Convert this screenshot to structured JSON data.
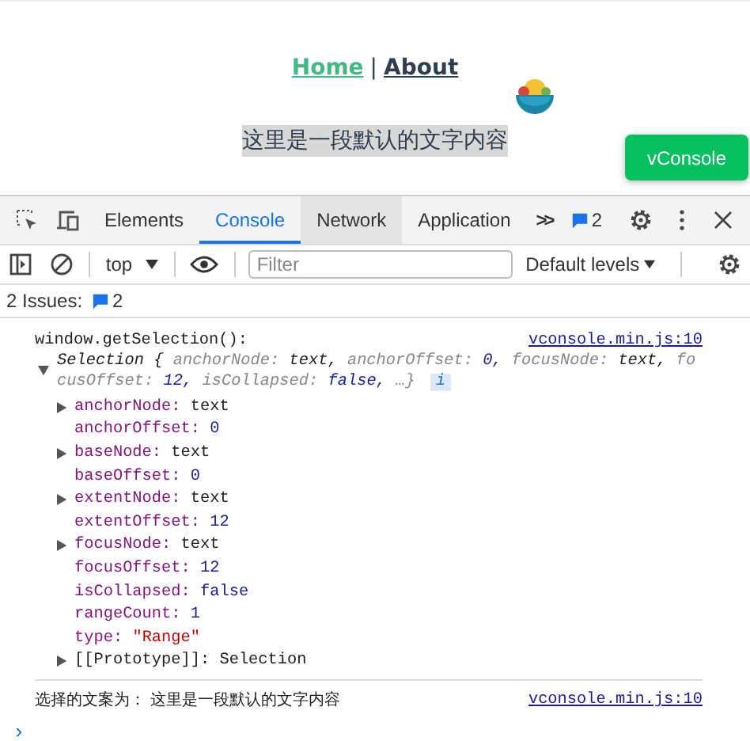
{
  "page": {
    "nav": [
      {
        "label": "Home",
        "selected": true
      },
      {
        "label": "About",
        "selected": false
      }
    ],
    "separator": "|",
    "selected_text": "这里是一段默认的文字内容",
    "vconsole_button": "vConsole"
  },
  "devtools": {
    "tabs": [
      {
        "label": "Elements",
        "selected": false,
        "hovered": false
      },
      {
        "label": "Console",
        "selected": true,
        "hovered": false
      },
      {
        "label": "Network",
        "selected": false,
        "hovered": true
      },
      {
        "label": "Application",
        "selected": false,
        "hovered": false
      }
    ],
    "more_tabs": ">>",
    "issues_badge": "2",
    "toolbar": {
      "context": "top",
      "filter_placeholder": "Filter",
      "levels": "Default levels"
    },
    "issues": {
      "label": "2 Issues:",
      "count": "2"
    },
    "console": {
      "log": "window.getSelection():",
      "source": "vconsole.min.js:10",
      "summary": {
        "parts": [
          {
            "text": "Selection {",
            "kind": "name"
          },
          {
            "text": "anchorNode:",
            "kind": "key"
          },
          {
            "text": "text,",
            "kind": "node"
          },
          {
            "text": "anchorOffset:",
            "kind": "key"
          },
          {
            "text": "0,",
            "kind": "number"
          },
          {
            "text": "focusNode:",
            "kind": "key"
          },
          {
            "text": "text,",
            "kind": "node"
          },
          {
            "text": "focusOffset:",
            "kind": "key"
          },
          {
            "text": "12,",
            "kind": "number"
          },
          {
            "text": "isCollapsed:",
            "kind": "key"
          },
          {
            "text": "false,",
            "kind": "boolean"
          },
          {
            "text": "…}",
            "kind": "key"
          }
        ],
        "info": "i",
        "expanded": true
      },
      "properties": [
        {
          "key": "anchorNode:",
          "value": "text",
          "kind": "node",
          "expandable": true
        },
        {
          "key": "anchorOffset:",
          "value": "0",
          "kind": "number",
          "expandable": false
        },
        {
          "key": "baseNode:",
          "value": "text",
          "kind": "node",
          "expandable": true
        },
        {
          "key": "baseOffset:",
          "value": "0",
          "kind": "number",
          "expandable": false
        },
        {
          "key": "extentNode:",
          "value": "text",
          "kind": "node",
          "expandable": true
        },
        {
          "key": "extentOffset:",
          "value": "12",
          "kind": "number",
          "expandable": false
        },
        {
          "key": "focusNode:",
          "value": "text",
          "kind": "node",
          "expandable": true
        },
        {
          "key": "focusOffset:",
          "value": "12",
          "kind": "number",
          "expandable": false
        },
        {
          "key": "isCollapsed:",
          "value": "false",
          "kind": "boolean",
          "expandable": false
        },
        {
          "key": "rangeCount:",
          "value": "1",
          "kind": "number",
          "expandable": false
        },
        {
          "key": "type:",
          "value": "\"Range\"",
          "kind": "string",
          "expandable": false
        },
        {
          "key": "[[Prototype]]:",
          "value": "Selection",
          "kind": "internal",
          "expandable": true
        }
      ],
      "message": "选择的文案为： 这里是一段默认的文字内容",
      "message_source": "vconsole.min.js:10",
      "prompt": "›"
    }
  }
}
